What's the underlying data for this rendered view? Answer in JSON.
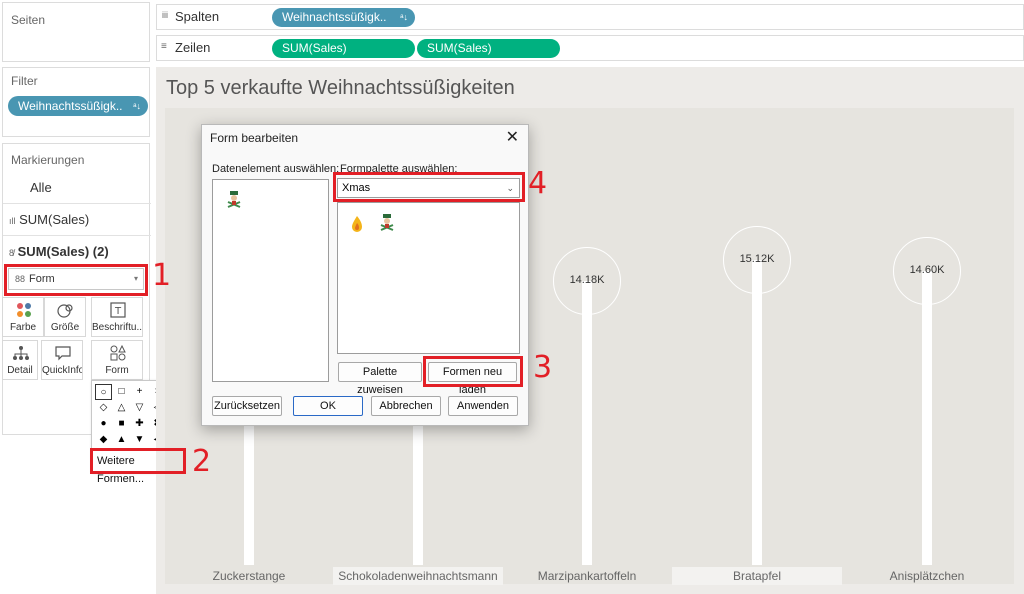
{
  "pages": {
    "title": "Seiten"
  },
  "filter": {
    "title": "Filter",
    "pill": "Weihnachtssüßigk.."
  },
  "marks": {
    "title": "Markierungen",
    "rows": [
      "Alle",
      "SUM(Sales)",
      "SUM(Sales) (2)"
    ],
    "mark_type": "Form",
    "tiles": [
      "Farbe",
      "Größe",
      "Beschriftu...",
      "Detail",
      "QuickInfo",
      "Form"
    ]
  },
  "shapes_popup": {
    "rows": [
      [
        "○",
        "□",
        "+",
        "×",
        "✱"
      ],
      [
        "◇",
        "△",
        "▽",
        "◁",
        "▷"
      ],
      [
        "●",
        "■",
        "✚",
        "✖",
        "★"
      ],
      [
        "◆",
        "▲",
        "▼",
        "◀",
        "▶"
      ]
    ],
    "more_label": "Weitere Formen..."
  },
  "shelves": {
    "columns_label": "Spalten",
    "columns_pill": "Weihnachtssüßigk..",
    "rows_label": "Zeilen",
    "rows_pills": [
      "SUM(Sales)",
      "SUM(Sales)"
    ]
  },
  "annotations": [
    "1",
    "2",
    "3",
    "4"
  ],
  "chart_data": {
    "type": "bar",
    "title": "Top 5 verkaufte Weihnachtssüßigkeiten",
    "categories": [
      "Zuckerstange",
      "Schokoladenweihnachtsmann",
      "Marzipankartoffeln",
      "Bratapfel",
      "Anisplätzchen"
    ],
    "value_labels": [
      "",
      "",
      "14.18K",
      "15.12K",
      "14.60K"
    ],
    "values": [
      null,
      null,
      14.18,
      15.12,
      14.6
    ],
    "unit": "K"
  },
  "dialog": {
    "title": "Form bearbeiten",
    "data_item_label": "Datenelement auswählen:",
    "palette_label": "Formpalette auswählen:",
    "palette_value": "Xmas",
    "buttons": {
      "assign": "Palette zuweisen",
      "reload": "Formen neu laden",
      "reset": "Zurücksetzen",
      "ok": "OK",
      "cancel": "Abbrechen",
      "apply": "Anwenden"
    }
  }
}
